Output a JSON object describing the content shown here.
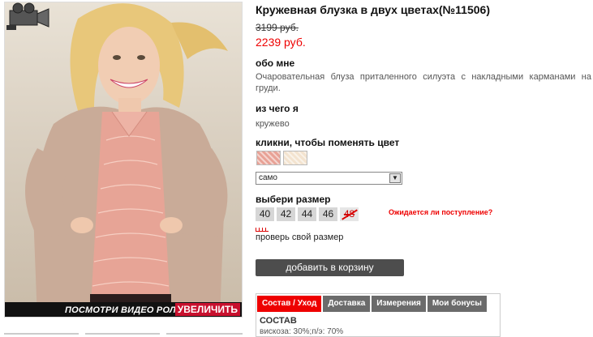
{
  "product": {
    "title": "Кружевная блузка в двух цветах(№11506)",
    "old_price": "3199 руб.",
    "new_price": "2239 руб."
  },
  "about": {
    "heading": "обо мне",
    "text": "Очаровательная блуза приталенного силуэта с накладными карманами на груди."
  },
  "material": {
    "heading": "из чего я",
    "text": "кружево"
  },
  "color": {
    "heading": "кликни, чтобы поменять цвет",
    "swatches": [
      "#e8a296",
      "#f3e3cf"
    ],
    "selected": "само"
  },
  "size": {
    "heading": "выбери размер",
    "options": [
      {
        "label": "40",
        "available": true
      },
      {
        "label": "42",
        "available": true
      },
      {
        "label": "44",
        "available": true
      },
      {
        "label": "46",
        "available": true
      },
      {
        "label": "48",
        "available": false
      }
    ],
    "expect_link": "Ожидается ли поступление?",
    "check_link": "проверь свой размер"
  },
  "cart": {
    "button_label": "добавить в корзину"
  },
  "photo": {
    "video_label": "ПОСМОТРИ ВИДЕО РОЛИК",
    "zoom_label": "УВЕЛИЧИТЬ"
  },
  "tabs": {
    "items": [
      {
        "label": "Состав / Уход",
        "active": true
      },
      {
        "label": "Доставка",
        "active": false
      },
      {
        "label": "Измерения",
        "active": false
      },
      {
        "label": "Мои бонусы",
        "active": false
      }
    ],
    "content_heading": "СОСТАВ",
    "content_text": "вискоза: 30%;п/э: 70%"
  },
  "colors": {
    "accent": "#e00000",
    "button": "#4d4d4d",
    "tab": "#6b6b6b"
  }
}
